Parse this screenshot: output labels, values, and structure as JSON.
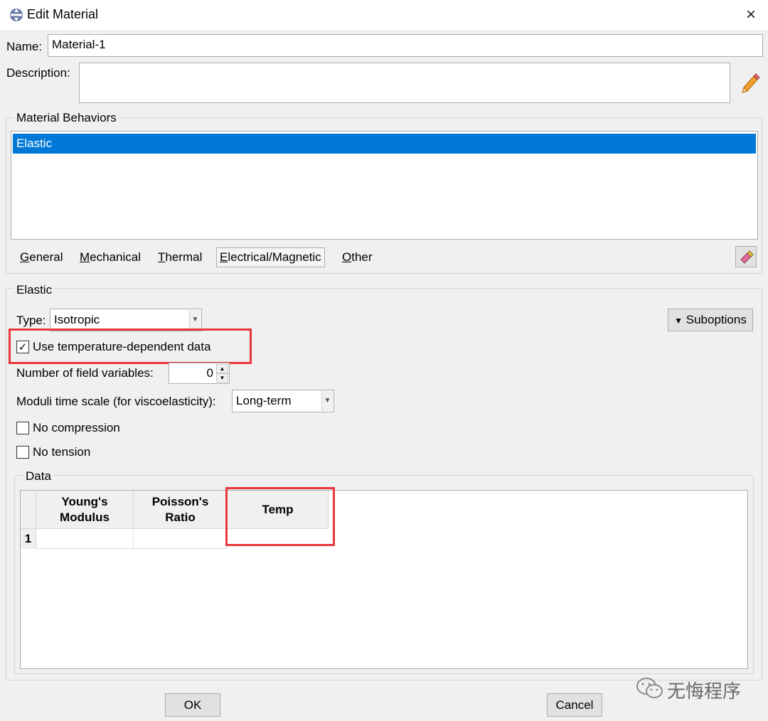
{
  "window": {
    "title": "Edit Material",
    "close_icon": "×"
  },
  "name": {
    "label": "Name:",
    "value": "Material-1"
  },
  "description": {
    "label": "Description:",
    "value": "",
    "edit_icon": "✎"
  },
  "behaviors": {
    "group_title": "Material Behaviors",
    "items": [
      "Elastic"
    ],
    "menu": [
      "General",
      "Mechanical",
      "Thermal",
      "Electrical/Magnetic",
      "Other"
    ],
    "eraser_icon": "✐"
  },
  "elastic": {
    "group_title": "Elastic",
    "type_label": "Type:",
    "type_value": "Isotropic",
    "suboptions_label": "Suboptions",
    "temp_dependent_label": "Use temperature-dependent data",
    "temp_dependent_checked": "✓",
    "field_vars_label": "Number of field variables:",
    "field_vars_value": "0",
    "moduli_label": "Moduli time scale (for viscoelasticity):",
    "moduli_value": "Long-term",
    "no_compression_label": "No compression",
    "no_tension_label": "No tension"
  },
  "data": {
    "group_title": "Data",
    "columns": [
      {
        "line1": "Young's",
        "line2": "Modulus"
      },
      {
        "line1": "Poisson's",
        "line2": "Ratio"
      },
      {
        "line1": "Temp",
        "line2": ""
      }
    ],
    "rows": [
      {
        "index": "1",
        "cells": [
          "",
          "",
          ""
        ]
      }
    ]
  },
  "buttons": {
    "ok": "OK",
    "cancel": "Cancel"
  },
  "watermark": {
    "text": "无悔程序"
  },
  "colors": {
    "selection": "#0078d7",
    "highlight_box": "#e8373b"
  }
}
